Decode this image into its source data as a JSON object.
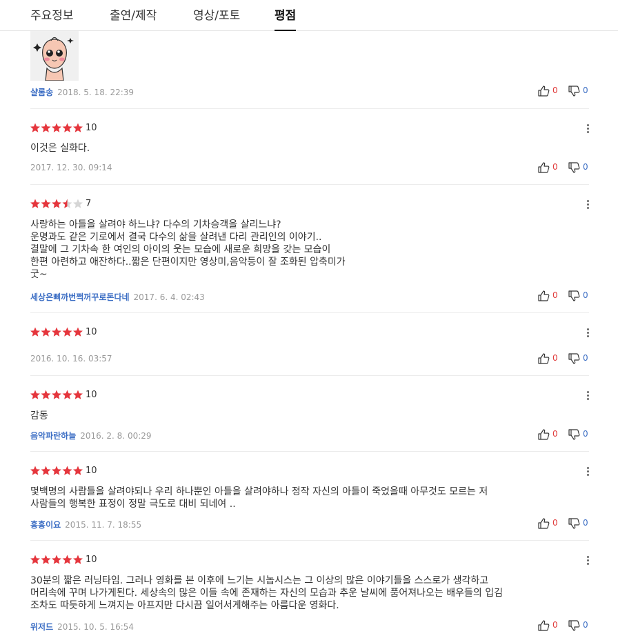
{
  "tabs": [
    "주요정보",
    "출연/제작",
    "영상/포토",
    "평점"
  ],
  "active_tab": "평점",
  "colors": {
    "star": "#e5363d",
    "star_empty": "#d6d6d6",
    "nick": "#3c6ec4",
    "like": "#e03c3c",
    "dislike": "#3c6ec4"
  },
  "top_comment": {
    "thumbnail": "peach-character-sticker",
    "nick": "샬롬송",
    "date": "2018. 5. 18. 22:39",
    "likes": "0",
    "dislikes": "0"
  },
  "reviews": [
    {
      "rating": 10,
      "stars": 5,
      "score": "10",
      "text": "이것은 실화다.",
      "nick": "",
      "date": "2017. 12. 30. 09:14",
      "likes": "0",
      "dislikes": "0"
    },
    {
      "rating": 7,
      "stars": 3.5,
      "score": "7",
      "text": "사랑하는 아들을 살려야 하느냐? 다수의 기차승객을 살리느냐?\n운명과도 같은 기로에서 결국 다수의 삶을 살려낸 다리 관리인의 이야기..\n결말에 그 기차속 한 여인의 아이의 웃는 모습에 새로운 희망을 갖는 모습이\n한편 아련하고 애잔하다..짧은 단편이지만 영상미,음악등이 잘 조화된 압축미가\n굿~",
      "nick": "세상은삐까번쩍꺼꾸로돈다네",
      "date": "2017. 6. 4. 02:43",
      "likes": "0",
      "dislikes": "0"
    },
    {
      "rating": 10,
      "stars": 5,
      "score": "10",
      "text": "",
      "nick": "",
      "date": "2016. 10. 16. 03:57",
      "likes": "0",
      "dislikes": "0"
    },
    {
      "rating": 10,
      "stars": 5,
      "score": "10",
      "text": "감동",
      "nick": "음악파란하늘",
      "date": "2016. 2. 8. 00:29",
      "likes": "0",
      "dislikes": "0"
    },
    {
      "rating": 10,
      "stars": 5,
      "score": "10",
      "text": "몇백명의 사람들을 살려야되나 우리 하나뿐인 아들을 살려야하나 정작 자신의 아들이 죽었을때 아무것도 모르는 저\n사람들의 행복한 표정이 정말 극도로 대비 되네여 ..",
      "nick": "흥흥이요",
      "date": "2015. 11. 7. 18:55",
      "likes": "0",
      "dislikes": "0"
    },
    {
      "rating": 10,
      "stars": 5,
      "score": "10",
      "text": "30분의 짧은 러닝타임. 그러나 영화를 본 이후에 느기는 시놉시스는 그 이상의 많은 이야기들을 스스로가 생각하고\n머리속에 꾸며 나가게된다. 세상속의 많은 이들 속에 존재하는 자신의 모습과 추운 날씨에 품어져나오는 배우들의 입김\n조차도 따듯하게 느껴지는 아프지만 다시끔 일어서게해주는 아름다운 영화다.",
      "nick": "위저드",
      "date": "2015. 10. 5. 16:54",
      "likes": "0",
      "dislikes": "0"
    }
  ]
}
